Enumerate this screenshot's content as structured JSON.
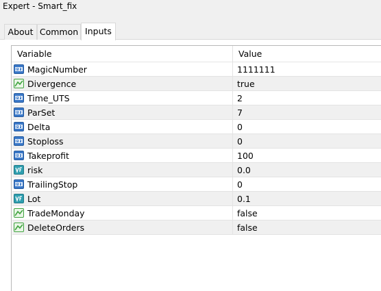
{
  "window": {
    "title": "Expert - Smart_fix"
  },
  "tabs": [
    {
      "label": "About",
      "active": false
    },
    {
      "label": "Common",
      "active": false
    },
    {
      "label": "Inputs",
      "active": true
    }
  ],
  "table": {
    "columns": [
      "Variable",
      "Value"
    ],
    "rows": [
      {
        "name": "MagicNumber",
        "value": "1111111",
        "type": "int"
      },
      {
        "name": "Divergence",
        "value": "true",
        "type": "bool"
      },
      {
        "name": "Time_UTS",
        "value": "2",
        "type": "int"
      },
      {
        "name": "ParSet",
        "value": "7",
        "type": "int"
      },
      {
        "name": "Delta",
        "value": "0",
        "type": "int"
      },
      {
        "name": "Stoploss",
        "value": "0",
        "type": "int"
      },
      {
        "name": "Takeprofit",
        "value": "100",
        "type": "int"
      },
      {
        "name": "risk",
        "value": "0.0",
        "type": "double"
      },
      {
        "name": "TrailingStop",
        "value": "0",
        "type": "int"
      },
      {
        "name": "Lot",
        "value": "0.1",
        "type": "double"
      },
      {
        "name": "TradeMonday",
        "value": "false",
        "type": "bool"
      },
      {
        "name": "DeleteOrders",
        "value": "false",
        "type": "bool"
      }
    ]
  },
  "icons": {
    "int": "integer-type-icon",
    "bool": "boolean-type-icon",
    "double": "double-type-icon"
  },
  "colors": {
    "int_icon": "#3a78c8",
    "double_icon": "#2f9fb0",
    "bool_icon": "#3fa33f",
    "row_alt": "#f0f0f0"
  }
}
